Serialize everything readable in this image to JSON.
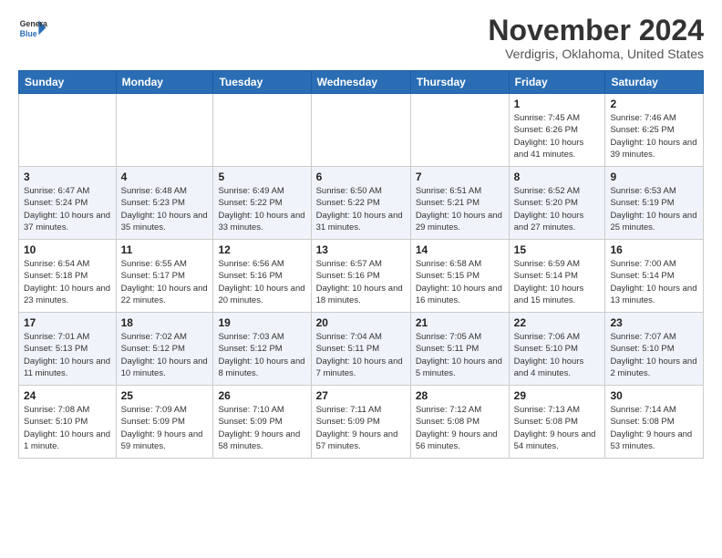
{
  "logo": {
    "line1": "General",
    "line2": "Blue"
  },
  "title": "November 2024",
  "subtitle": "Verdigris, Oklahoma, United States",
  "days_of_week": [
    "Sunday",
    "Monday",
    "Tuesday",
    "Wednesday",
    "Thursday",
    "Friday",
    "Saturday"
  ],
  "weeks": [
    [
      {
        "day": "",
        "info": ""
      },
      {
        "day": "",
        "info": ""
      },
      {
        "day": "",
        "info": ""
      },
      {
        "day": "",
        "info": ""
      },
      {
        "day": "",
        "info": ""
      },
      {
        "day": "1",
        "info": "Sunrise: 7:45 AM\nSunset: 6:26 PM\nDaylight: 10 hours and 41 minutes."
      },
      {
        "day": "2",
        "info": "Sunrise: 7:46 AM\nSunset: 6:25 PM\nDaylight: 10 hours and 39 minutes."
      }
    ],
    [
      {
        "day": "3",
        "info": "Sunrise: 6:47 AM\nSunset: 5:24 PM\nDaylight: 10 hours and 37 minutes."
      },
      {
        "day": "4",
        "info": "Sunrise: 6:48 AM\nSunset: 5:23 PM\nDaylight: 10 hours and 35 minutes."
      },
      {
        "day": "5",
        "info": "Sunrise: 6:49 AM\nSunset: 5:22 PM\nDaylight: 10 hours and 33 minutes."
      },
      {
        "day": "6",
        "info": "Sunrise: 6:50 AM\nSunset: 5:22 PM\nDaylight: 10 hours and 31 minutes."
      },
      {
        "day": "7",
        "info": "Sunrise: 6:51 AM\nSunset: 5:21 PM\nDaylight: 10 hours and 29 minutes."
      },
      {
        "day": "8",
        "info": "Sunrise: 6:52 AM\nSunset: 5:20 PM\nDaylight: 10 hours and 27 minutes."
      },
      {
        "day": "9",
        "info": "Sunrise: 6:53 AM\nSunset: 5:19 PM\nDaylight: 10 hours and 25 minutes."
      }
    ],
    [
      {
        "day": "10",
        "info": "Sunrise: 6:54 AM\nSunset: 5:18 PM\nDaylight: 10 hours and 23 minutes."
      },
      {
        "day": "11",
        "info": "Sunrise: 6:55 AM\nSunset: 5:17 PM\nDaylight: 10 hours and 22 minutes."
      },
      {
        "day": "12",
        "info": "Sunrise: 6:56 AM\nSunset: 5:16 PM\nDaylight: 10 hours and 20 minutes."
      },
      {
        "day": "13",
        "info": "Sunrise: 6:57 AM\nSunset: 5:16 PM\nDaylight: 10 hours and 18 minutes."
      },
      {
        "day": "14",
        "info": "Sunrise: 6:58 AM\nSunset: 5:15 PM\nDaylight: 10 hours and 16 minutes."
      },
      {
        "day": "15",
        "info": "Sunrise: 6:59 AM\nSunset: 5:14 PM\nDaylight: 10 hours and 15 minutes."
      },
      {
        "day": "16",
        "info": "Sunrise: 7:00 AM\nSunset: 5:14 PM\nDaylight: 10 hours and 13 minutes."
      }
    ],
    [
      {
        "day": "17",
        "info": "Sunrise: 7:01 AM\nSunset: 5:13 PM\nDaylight: 10 hours and 11 minutes."
      },
      {
        "day": "18",
        "info": "Sunrise: 7:02 AM\nSunset: 5:12 PM\nDaylight: 10 hours and 10 minutes."
      },
      {
        "day": "19",
        "info": "Sunrise: 7:03 AM\nSunset: 5:12 PM\nDaylight: 10 hours and 8 minutes."
      },
      {
        "day": "20",
        "info": "Sunrise: 7:04 AM\nSunset: 5:11 PM\nDaylight: 10 hours and 7 minutes."
      },
      {
        "day": "21",
        "info": "Sunrise: 7:05 AM\nSunset: 5:11 PM\nDaylight: 10 hours and 5 minutes."
      },
      {
        "day": "22",
        "info": "Sunrise: 7:06 AM\nSunset: 5:10 PM\nDaylight: 10 hours and 4 minutes."
      },
      {
        "day": "23",
        "info": "Sunrise: 7:07 AM\nSunset: 5:10 PM\nDaylight: 10 hours and 2 minutes."
      }
    ],
    [
      {
        "day": "24",
        "info": "Sunrise: 7:08 AM\nSunset: 5:10 PM\nDaylight: 10 hours and 1 minute."
      },
      {
        "day": "25",
        "info": "Sunrise: 7:09 AM\nSunset: 5:09 PM\nDaylight: 9 hours and 59 minutes."
      },
      {
        "day": "26",
        "info": "Sunrise: 7:10 AM\nSunset: 5:09 PM\nDaylight: 9 hours and 58 minutes."
      },
      {
        "day": "27",
        "info": "Sunrise: 7:11 AM\nSunset: 5:09 PM\nDaylight: 9 hours and 57 minutes."
      },
      {
        "day": "28",
        "info": "Sunrise: 7:12 AM\nSunset: 5:08 PM\nDaylight: 9 hours and 56 minutes."
      },
      {
        "day": "29",
        "info": "Sunrise: 7:13 AM\nSunset: 5:08 PM\nDaylight: 9 hours and 54 minutes."
      },
      {
        "day": "30",
        "info": "Sunrise: 7:14 AM\nSunset: 5:08 PM\nDaylight: 9 hours and 53 minutes."
      }
    ]
  ]
}
